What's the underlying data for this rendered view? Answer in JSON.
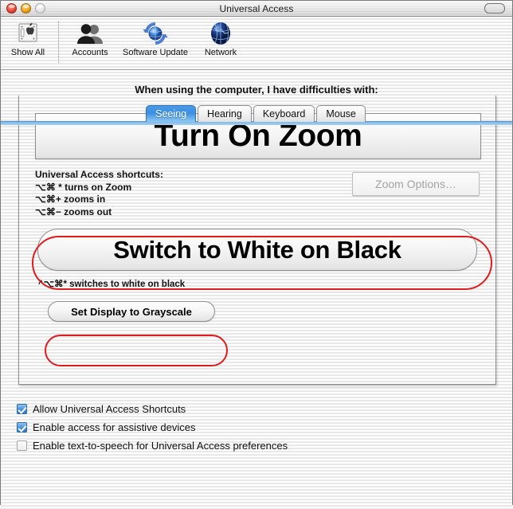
{
  "window": {
    "title": "Universal Access",
    "controls": {
      "close": "close-button",
      "minimize": "minimize-button",
      "zoom": "zoom-button",
      "toolbar_toggle": "toolbar-toggle-button"
    }
  },
  "toolbar": {
    "items": [
      {
        "label": "Show All",
        "icon": "show-all-icon"
      },
      {
        "label": "Accounts",
        "icon": "accounts-icon"
      },
      {
        "label": "Software Update",
        "icon": "software-update-icon"
      },
      {
        "label": "Network",
        "icon": "network-icon"
      }
    ]
  },
  "main": {
    "prompt": "When using the computer, I have difficulties with:",
    "tabs": [
      {
        "label": "Seeing",
        "active": true
      },
      {
        "label": "Hearing",
        "active": false
      },
      {
        "label": "Keyboard",
        "active": false
      },
      {
        "label": "Mouse",
        "active": false
      }
    ],
    "zoom_button": "Turn On Zoom",
    "zoom_options_button": "Zoom Options…",
    "shortcuts": {
      "heading": "Universal Access shortcuts:",
      "lines": [
        "⌥⌘ * turns on Zoom",
        "⌥⌘+ zooms in",
        "⌥⌘− zooms out"
      ]
    },
    "white_on_black_button": "Switch to White on Black",
    "white_on_black_caption": "^⌥⌘* switches to white on black",
    "grayscale_button": "Set Display to Grayscale"
  },
  "checkboxes": [
    {
      "label": "Allow Universal Access Shortcuts",
      "checked": true
    },
    {
      "label": "Enable access for assistive devices",
      "checked": true
    },
    {
      "label": "Enable text-to-speech for Universal Access preferences",
      "checked": false
    }
  ],
  "colors": {
    "accent_blue": "#3b8fe3",
    "annotation_red": "#e01b1b",
    "disabled_gray": "#a3a3a3"
  }
}
